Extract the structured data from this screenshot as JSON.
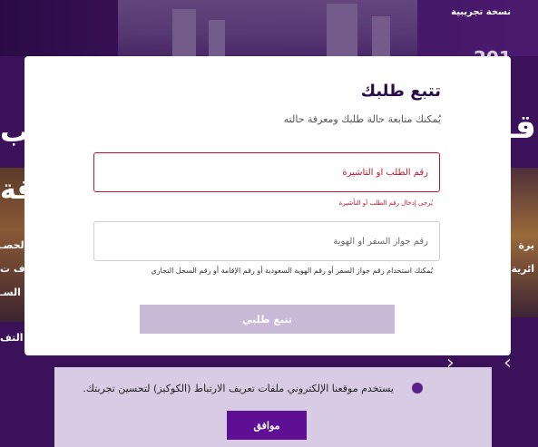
{
  "background": {
    "version_label": "نسخة تجريبية",
    "peeks": [
      "قـ",
      "تتب",
      "قة",
      "لحصـ",
      "يرة",
      "ف ت",
      "ائرية",
      "السـ",
      "ن التف",
      "201"
    ]
  },
  "modal": {
    "title": "تتبع طلبك",
    "subtitle": "يُمكنك متابعة حالة طلبك ومعرفة حالته",
    "request_field": {
      "placeholder": "رقم الطلب أو التأشيرة",
      "value": "",
      "error": "يُرجى إدخال رقم الطلب أو التأشيرة"
    },
    "id_field": {
      "placeholder": "رقم جواز السفر أو الهوية",
      "value": "",
      "hint": "يُمكنك استخدام رقم جواز السفر أو رقم الهوية السعودية أو رقم الإقامة أو رقم السجل التجاري"
    },
    "submit_label": "تتبع طلبي"
  },
  "cookie_bar": {
    "message": "يستخدم موقعنا الإلكتروني ملفات تعريف الارتباط (الكوكيز) لتحسين تجربتك.",
    "accept_label": "موافق"
  },
  "colors": {
    "brand": "#5e0f94",
    "error": "#c0142b",
    "submit_disabled": "#c8bad6",
    "backdrop": "#3a1158"
  }
}
